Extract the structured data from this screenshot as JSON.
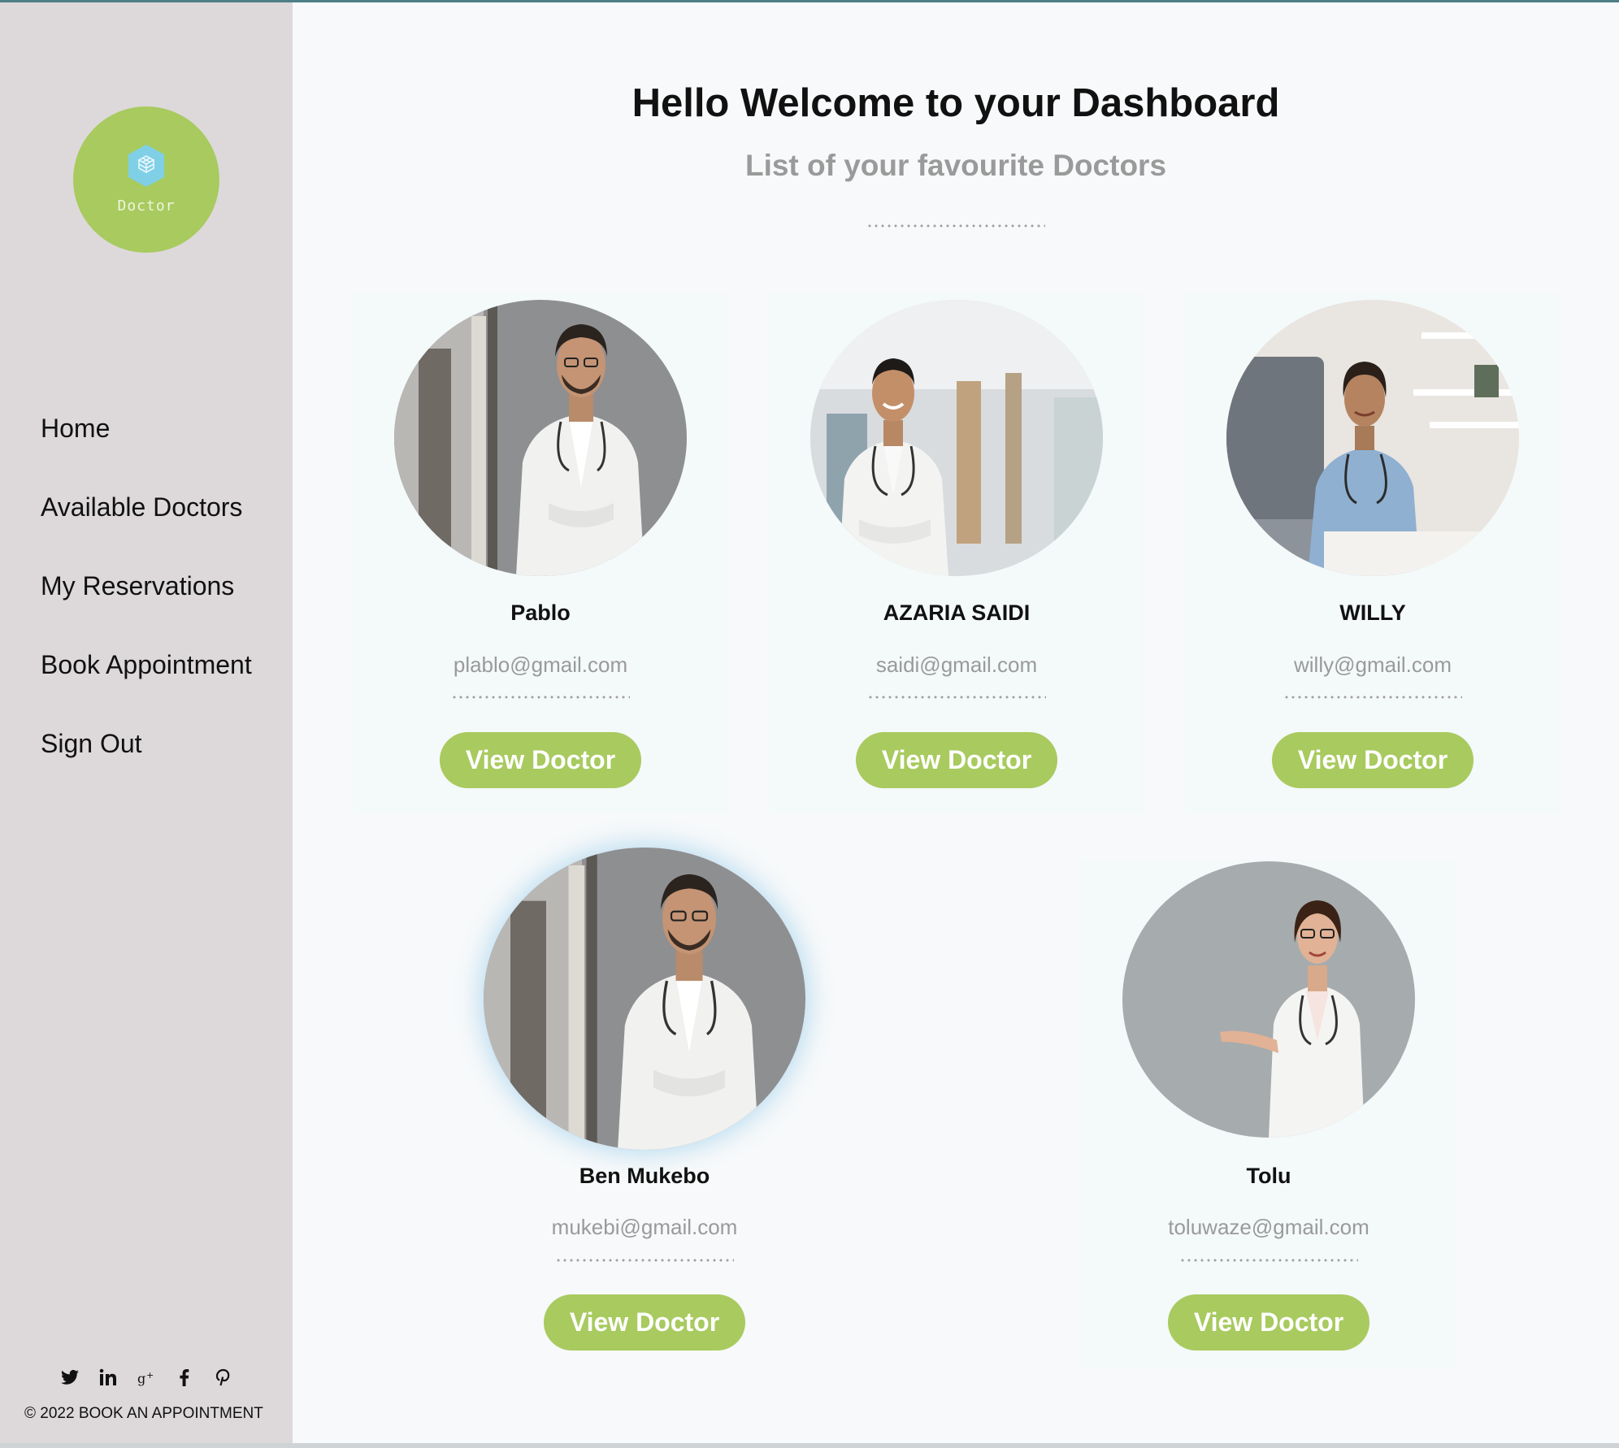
{
  "brand": {
    "logo_text": "Doctor",
    "accent_color": "#a8ca5f",
    "logo_icon": "cube-icon"
  },
  "sidebar": {
    "items": [
      {
        "label": "Home"
      },
      {
        "label": "Available Doctors"
      },
      {
        "label": "My Reservations"
      },
      {
        "label": "Book Appointment"
      },
      {
        "label": "Sign Out"
      }
    ],
    "social_icons": [
      "twitter-icon",
      "linkedin-icon",
      "google-plus-icon",
      "facebook-icon",
      "pinterest-icon"
    ],
    "copyright": "© 2022 BOOK AN APPOINTMENT"
  },
  "main": {
    "title": "Hello Welcome to your Dashboard",
    "subtitle": "List of your favourite Doctors"
  },
  "doctors": [
    {
      "name": "Pablo",
      "email": "plablo@gmail.com",
      "button": "View Doctor"
    },
    {
      "name": "AZARIA SAIDI",
      "email": "saidi@gmail.com",
      "button": "View Doctor"
    },
    {
      "name": "WILLY",
      "email": "willy@gmail.com",
      "button": "View Doctor"
    },
    {
      "name": "Ben Mukebo",
      "email": "mukebi@gmail.com",
      "button": "View Doctor"
    },
    {
      "name": "Tolu",
      "email": "toluwaze@gmail.com",
      "button": "View Doctor"
    }
  ]
}
